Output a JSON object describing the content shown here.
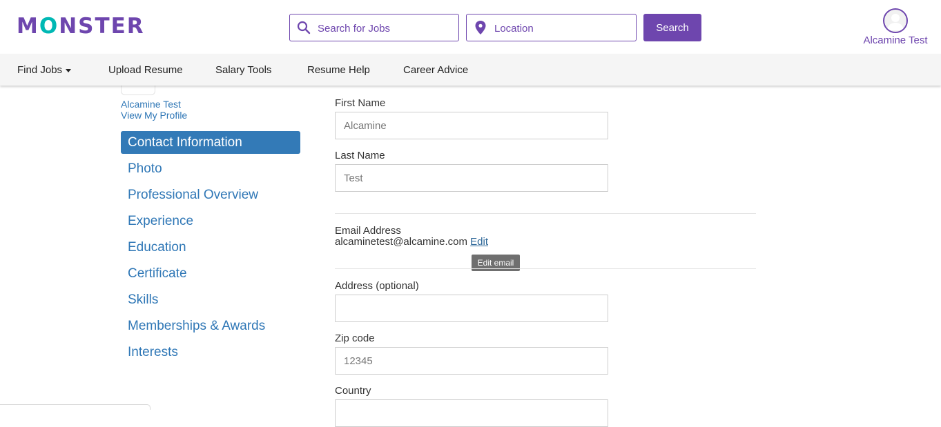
{
  "header": {
    "logo": {
      "pre": "M",
      "o": "O",
      "post": "NSTER"
    },
    "search_jobs_placeholder": "Search for Jobs",
    "location_placeholder": "Location",
    "search_button": "Search",
    "user_name": "Alcamine Test"
  },
  "nav": {
    "items": [
      {
        "label": "Find Jobs",
        "has_caret": true
      },
      {
        "label": "Upload Resume"
      },
      {
        "label": "Salary Tools"
      },
      {
        "label": "Resume Help"
      },
      {
        "label": "Career Advice"
      }
    ]
  },
  "sidebar": {
    "profile_name": "Alcamine Test",
    "view_profile": "View My Profile",
    "menu": [
      {
        "label": "Contact Information",
        "active": true
      },
      {
        "label": "Photo"
      },
      {
        "label": "Professional Overview"
      },
      {
        "label": "Experience"
      },
      {
        "label": "Education"
      },
      {
        "label": "Certificate"
      },
      {
        "label": "Skills"
      },
      {
        "label": "Memberships & Awards"
      },
      {
        "label": "Interests"
      }
    ]
  },
  "form": {
    "first_name_label": "First Name",
    "first_name_placeholder": "Alcamine",
    "last_name_label": "Last Name",
    "last_name_placeholder": "Test",
    "email_label": "Email Address",
    "email_value": "alcaminetest@alcamine.com",
    "email_edit": "Edit",
    "email_tooltip": "Edit email",
    "address_label": "Address (optional)",
    "address_value": "",
    "zip_label": "Zip code",
    "zip_placeholder": "12345",
    "country_label": "Country"
  },
  "colors": {
    "brand_purple": "#6e46ae",
    "brand_teal": "#00b8b4",
    "link_blue": "#2f77b6",
    "active_blue": "#337ab7"
  }
}
